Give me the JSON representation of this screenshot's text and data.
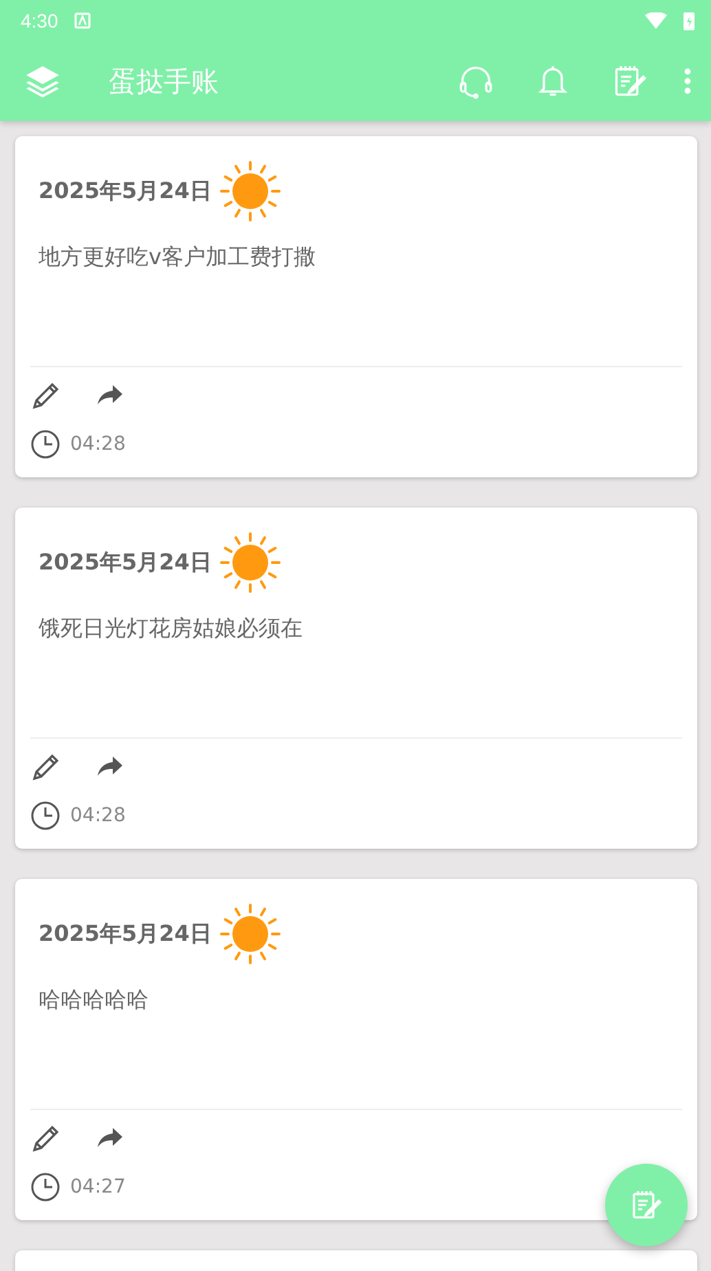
{
  "status_bar": {
    "time": "4:30"
  },
  "app_bar": {
    "title": "蛋挞手账"
  },
  "entries": [
    {
      "kind": "entry",
      "date": "2025年5月24日",
      "text": "地方更好吃v客户加工费打撒",
      "time": "04:28"
    },
    {
      "kind": "entry",
      "date": "2025年5月24日",
      "text": "饿死日光灯花房姑娘必须在",
      "time": "04:28"
    },
    {
      "kind": "entry",
      "date": "2025年5月24日",
      "text": "哈哈哈哈哈",
      "time": "04:27"
    },
    {
      "kind": "partial"
    }
  ]
}
